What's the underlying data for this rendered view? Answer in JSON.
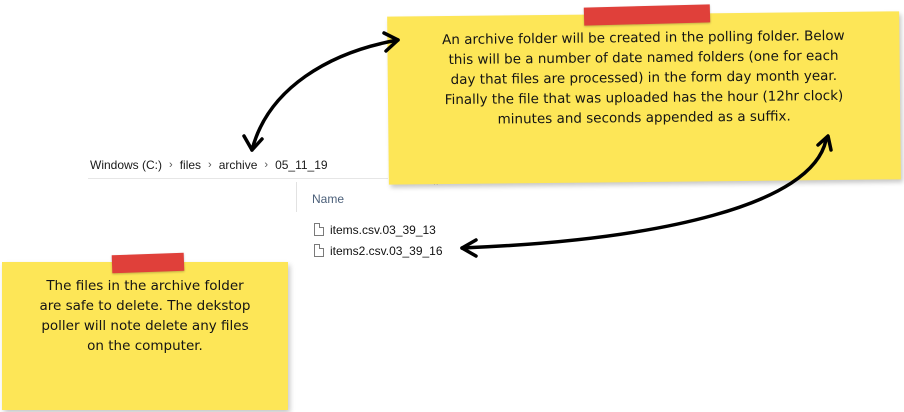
{
  "breadcrumb": {
    "items": [
      "Windows (C:)",
      "files",
      "archive",
      "05_11_19"
    ],
    "separator": "›"
  },
  "file_list": {
    "column_header": "Name",
    "sort_icon": "sort-up-icon",
    "files": [
      {
        "name": "items.csv.03_39_13",
        "icon": "file-icon"
      },
      {
        "name": "items2.csv.03_39_16",
        "icon": "file-icon"
      }
    ]
  },
  "notes": {
    "top_lines": [
      "An archive folder will be created in the polling folder.  Below",
      "this will be a number of date named folders (one for each",
      "day that files are processed) in the form day month year.",
      "Finally the file that was uploaded has the hour (12hr clock)",
      "minutes and seconds appended as a suffix."
    ],
    "left_lines": [
      "The files in the archive folder",
      "are safe to delete.  The dekstop",
      "poller will note delete any files",
      "on the computer."
    ]
  },
  "colors": {
    "note_yellow": "#fde657",
    "tape_red": "#e0403a",
    "arrow": "#000000",
    "header_text": "#4c607a"
  }
}
